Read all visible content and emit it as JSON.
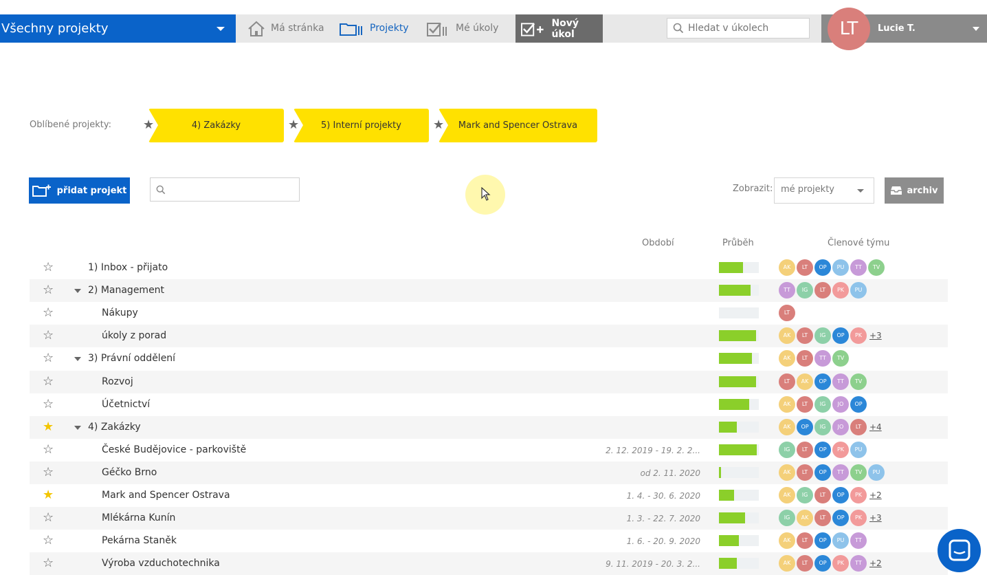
{
  "header": {
    "project_select": "Všechny projekty",
    "nav": {
      "home": "Má stránka",
      "projects": "Projekty",
      "tasks": "Mé úkoly",
      "new_task": "Nový úkol"
    },
    "search_placeholder": "Hledat v úkolech",
    "user": {
      "initials": "LT",
      "name": "Lucie T."
    }
  },
  "favorites": {
    "label": "Oblíbené projekty:",
    "items": [
      "4) Zakázky",
      "5) Interní projekty",
      "Mark and Spencer Ostrava"
    ]
  },
  "toolbar": {
    "add_project": "přidat projekt",
    "show_label": "Zobrazit:",
    "show_value": "mé projekty",
    "archive": "archiv"
  },
  "table": {
    "headers": {
      "period": "Období",
      "progress": "Průběh",
      "members": "Členové týmu"
    },
    "rows": [
      {
        "name": "1) Inbox - přijato",
        "level": 0,
        "toggle": false,
        "starred": false,
        "period": "",
        "progress": 0.6,
        "members": [
          "AK",
          "LT",
          "OP",
          "PU",
          "TT",
          "TV"
        ],
        "more": ""
      },
      {
        "name": "2) Management",
        "level": 0,
        "toggle": true,
        "starred": false,
        "period": "",
        "progress": 0.8,
        "members": [
          "TT",
          "IG",
          "LT",
          "PK",
          "PU"
        ],
        "more": ""
      },
      {
        "name": "Nákupy",
        "level": 1,
        "toggle": false,
        "starred": false,
        "period": "",
        "progress": 0,
        "members": [
          "LT"
        ],
        "more": ""
      },
      {
        "name": "úkoly z porad",
        "level": 1,
        "toggle": false,
        "starred": false,
        "period": "",
        "progress": 0.93,
        "members": [
          "AK",
          "LT",
          "IG",
          "OP",
          "PK"
        ],
        "more": "+3"
      },
      {
        "name": "3) Právní oddělení",
        "level": 0,
        "toggle": true,
        "starred": false,
        "period": "",
        "progress": 0.83,
        "members": [
          "AK",
          "LT",
          "TT",
          "TV"
        ],
        "more": ""
      },
      {
        "name": "Rozvoj",
        "level": 1,
        "toggle": false,
        "starred": false,
        "period": "",
        "progress": 0.93,
        "members": [
          "LT",
          "AK",
          "OP",
          "TT",
          "TV"
        ],
        "more": ""
      },
      {
        "name": "Účetnictví",
        "level": 1,
        "toggle": false,
        "starred": false,
        "period": "",
        "progress": 0.76,
        "members": [
          "AK",
          "LT",
          "IG",
          "JO",
          "OP"
        ],
        "more": ""
      },
      {
        "name": "4) Zakázky",
        "level": 0,
        "toggle": true,
        "starred": true,
        "period": "",
        "progress": 0.45,
        "members": [
          "AK",
          "OP",
          "IG",
          "JO",
          "LT"
        ],
        "more": "+4"
      },
      {
        "name": "České Budějovice - parkoviště",
        "level": 1,
        "toggle": false,
        "starred": false,
        "period": "2. 12. 2019 - 19. 2. 2...",
        "progress": 0.95,
        "members": [
          "IG",
          "LT",
          "OP",
          "PK",
          "PU"
        ],
        "more": ""
      },
      {
        "name": "Géčko Brno",
        "level": 1,
        "toggle": false,
        "starred": false,
        "period": "od 2. 11. 2020",
        "progress": 0.06,
        "members": [
          "AK",
          "LT",
          "OP",
          "TT",
          "TV",
          "PU"
        ],
        "more": ""
      },
      {
        "name": "Mark and Spencer Ostrava",
        "level": 1,
        "toggle": false,
        "starred": true,
        "period": "1. 4. - 30. 6. 2020",
        "progress": 0.38,
        "members": [
          "AK",
          "IG",
          "LT",
          "OP",
          "PK"
        ],
        "more": "+2"
      },
      {
        "name": "Mlékárna Kunín",
        "level": 1,
        "toggle": false,
        "starred": false,
        "period": "1. 3. - 22. 7. 2020",
        "progress": 0.66,
        "members": [
          "IG",
          "AK",
          "LT",
          "OP",
          "PK"
        ],
        "more": "+3"
      },
      {
        "name": "Pekárna Staněk",
        "level": 1,
        "toggle": false,
        "starred": false,
        "period": "1. 6. - 20. 9. 2020",
        "progress": 0.5,
        "members": [
          "AK",
          "LT",
          "OP",
          "PU",
          "TT"
        ],
        "more": ""
      },
      {
        "name": "Výroba vzduchotechnika",
        "level": 1,
        "toggle": false,
        "starred": false,
        "period": "9. 11. 2019 - 20. 3. 2...",
        "progress": 0.45,
        "members": [
          "AK",
          "LT",
          "OP",
          "PK",
          "TT"
        ],
        "more": "+2"
      }
    ]
  },
  "member_colors": {
    "AK": "#f4d07a",
    "LT": "#d97f7b",
    "OP": "#2b87d8",
    "PU": "#8ec3ea",
    "TT": "#c79ad8",
    "TV": "#8dd08d",
    "IG": "#8dd0a8",
    "PK": "#f29a9a",
    "JO": "#c79ad8"
  }
}
